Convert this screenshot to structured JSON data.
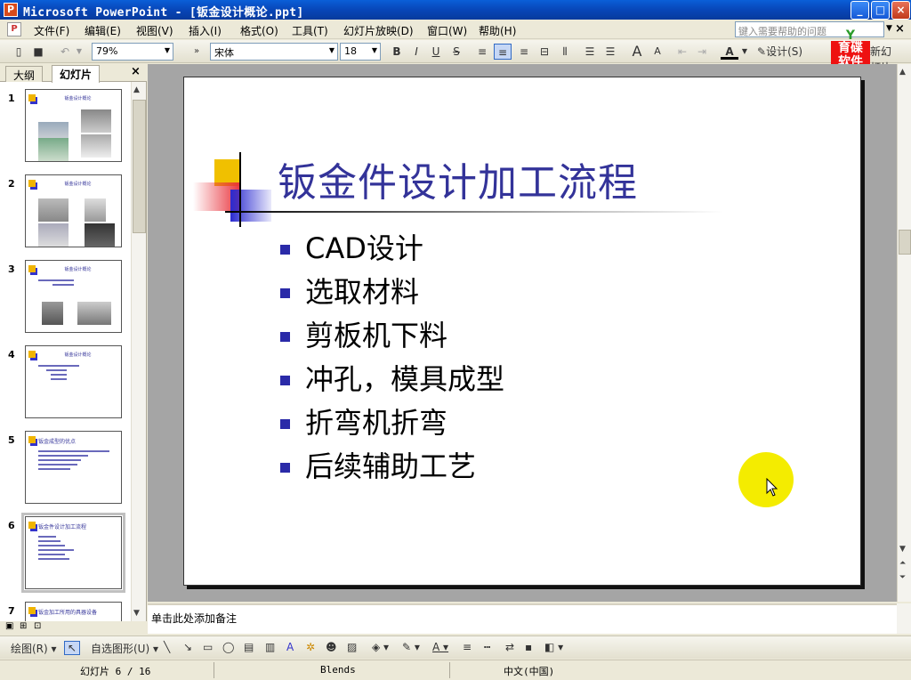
{
  "window": {
    "title": "Microsoft PowerPoint - [钣金设计概论.ppt]",
    "app_icon": "powerpoint-icon"
  },
  "menubar": {
    "items": [
      "文件(F)",
      "编辑(E)",
      "视图(V)",
      "插入(I)",
      "格式(O)",
      "工具(T)",
      "幻灯片放映(D)",
      "窗口(W)",
      "帮助(H)"
    ],
    "help_placeholder": "键入需要帮助的问题"
  },
  "toolbar": {
    "zoom": "79%",
    "font": "宋体",
    "font_size": "18",
    "bold": "B",
    "italic": "I",
    "underline": "U",
    "shadow": "S",
    "design_label": "设计(S)",
    "new_slide_label": "新幻灯片(N)"
  },
  "logo": {
    "line1": "育碟",
    "line2": "软件"
  },
  "left_panel": {
    "tabs": [
      "大纲",
      "幻灯片"
    ],
    "active_tab": "幻灯片",
    "thumbs": [
      {
        "num": "1",
        "title": "钣金设计概论"
      },
      {
        "num": "2",
        "title": "钣金设计概论"
      },
      {
        "num": "3",
        "title": "钣金设计概论"
      },
      {
        "num": "4",
        "title": "钣金设计概论"
      },
      {
        "num": "5",
        "title": "钣金成型的优点"
      },
      {
        "num": "6",
        "title": "钣金件设计加工流程"
      },
      {
        "num": "7",
        "title": "钣金加工所用的具器设备"
      }
    ]
  },
  "slide": {
    "title": "钣金件设计加工流程",
    "bullets": [
      "CAD设计",
      "选取材料",
      "剪板机下料",
      "冲孔，模具成型",
      "折弯机折弯",
      "后续辅助工艺"
    ]
  },
  "notes": {
    "placeholder": "单击此处添加备注"
  },
  "drawbar": {
    "draw_label": "绘图(R)",
    "autoshape_label": "自选图形(U)"
  },
  "statusbar": {
    "slide_info": "幻灯片 6 / 16",
    "template": "Blends",
    "language": "中文(中国)"
  },
  "colors": {
    "title_color": "#333399",
    "bullet_color": "#2a2aa8",
    "highlight": "#f4ec00"
  }
}
